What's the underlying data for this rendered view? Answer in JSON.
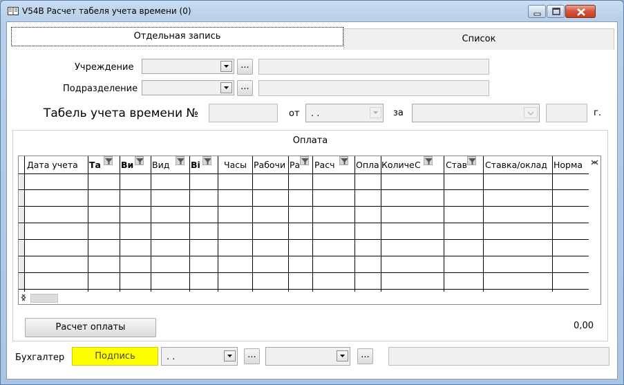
{
  "window": {
    "title": "V54B Расчет табеля учета времени (0)"
  },
  "tabs": {
    "record": "Отдельная запись",
    "list": "Список"
  },
  "form": {
    "institution_label": "Учреждение",
    "division_label": "Подразделение",
    "timesheet_label": "Табель учета времени №",
    "from_label": "от",
    "date_value": ". .",
    "for_label": "за",
    "year_suffix": "г.",
    "ellipsis": "..."
  },
  "payment": {
    "title": "Оплата",
    "columns": [
      "Дата учета",
      "Та",
      "Ви",
      "Вид",
      "Ві",
      "Часы",
      "Рабочи",
      "Ра",
      "Расч",
      "Опла",
      "Количе",
      "С",
      "Став",
      "Ставка/оклад",
      "Норма"
    ],
    "calc_button": "Расчет оплаты",
    "total": "0,00"
  },
  "footer": {
    "accountant_label": "Бухгалтер",
    "sign_button": "Подпись",
    "date_value": ". .",
    "ellipsis": "..."
  },
  "colors": {
    "sign_bg": "#ffff00",
    "accent": "#c13f22"
  },
  "icons": [
    "window-icon",
    "minimize-icon",
    "maximize-icon",
    "close-icon",
    "chevron-down-icon",
    "filter-icon",
    "scroll-up-icon",
    "scroll-down-icon",
    "scroll-left-icon",
    "scroll-right-icon"
  ]
}
